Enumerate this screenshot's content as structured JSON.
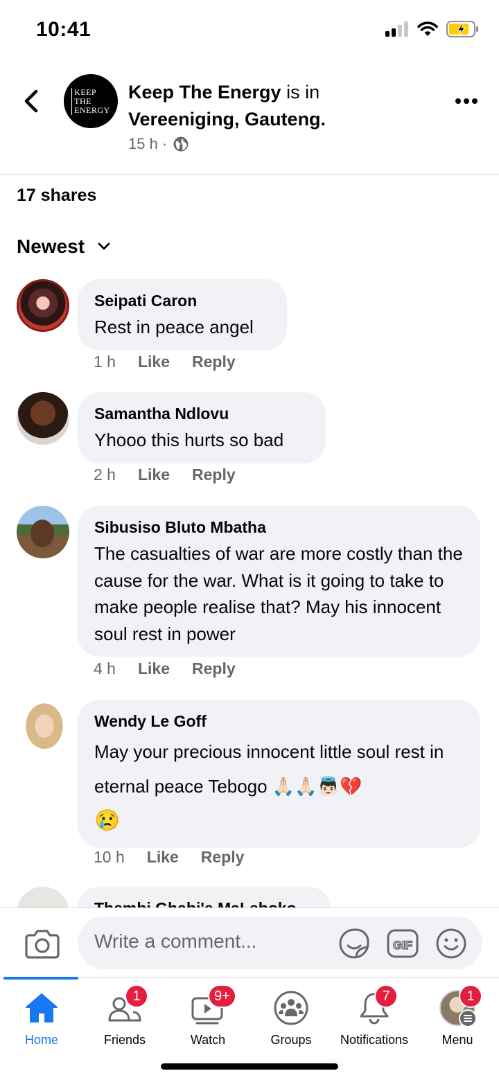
{
  "status": {
    "time": "10:41"
  },
  "post": {
    "page_name": "Keep The Energy",
    "is_in": "is in",
    "location": "Vereeniging, Gauteng.",
    "time": "15 h ·",
    "avatar_text": [
      "KEEP",
      "THE",
      "ENERGY"
    ]
  },
  "shares": "17 shares",
  "sort": {
    "label": "Newest"
  },
  "comments": [
    {
      "name": "Seipati Caron",
      "text": "Rest in peace angel",
      "time": "1 h",
      "like": "Like",
      "reply": "Reply"
    },
    {
      "name": "Samantha Ndlovu",
      "text": "Yhooo this hurts so bad",
      "time": "2 h",
      "like": "Like",
      "reply": "Reply"
    },
    {
      "name": "Sibusiso Bluto Mbatha",
      "text": "The casualties of war are more costly than the cause for the war. What is it going to take to make people realise that? May his innocent soul rest in power",
      "time": "4 h",
      "like": "Like",
      "reply": "Reply"
    },
    {
      "name": "Wendy Le Goff",
      "text": "May your precious innocent little soul rest in eternal peace Tebogo 🙏🏻🙏🏻👼🏻💔",
      "text2": "😢",
      "time": "10 h",
      "like": "Like",
      "reply": "Reply"
    },
    {
      "name": "Thembi Ghabi'e MaLeboko"
    }
  ],
  "composer": {
    "placeholder": "Write a comment..."
  },
  "tabs": [
    {
      "label": "Home",
      "badge": ""
    },
    {
      "label": "Friends",
      "badge": "1"
    },
    {
      "label": "Watch",
      "badge": "9+"
    },
    {
      "label": "Groups",
      "badge": ""
    },
    {
      "label": "Notifications",
      "badge": "7"
    },
    {
      "label": "Menu",
      "badge": "1"
    }
  ],
  "colors": {
    "accent": "#1877f2",
    "badge": "#e41e3f",
    "bubble": "#f0f2f5",
    "secondary_text": "#65676b"
  }
}
